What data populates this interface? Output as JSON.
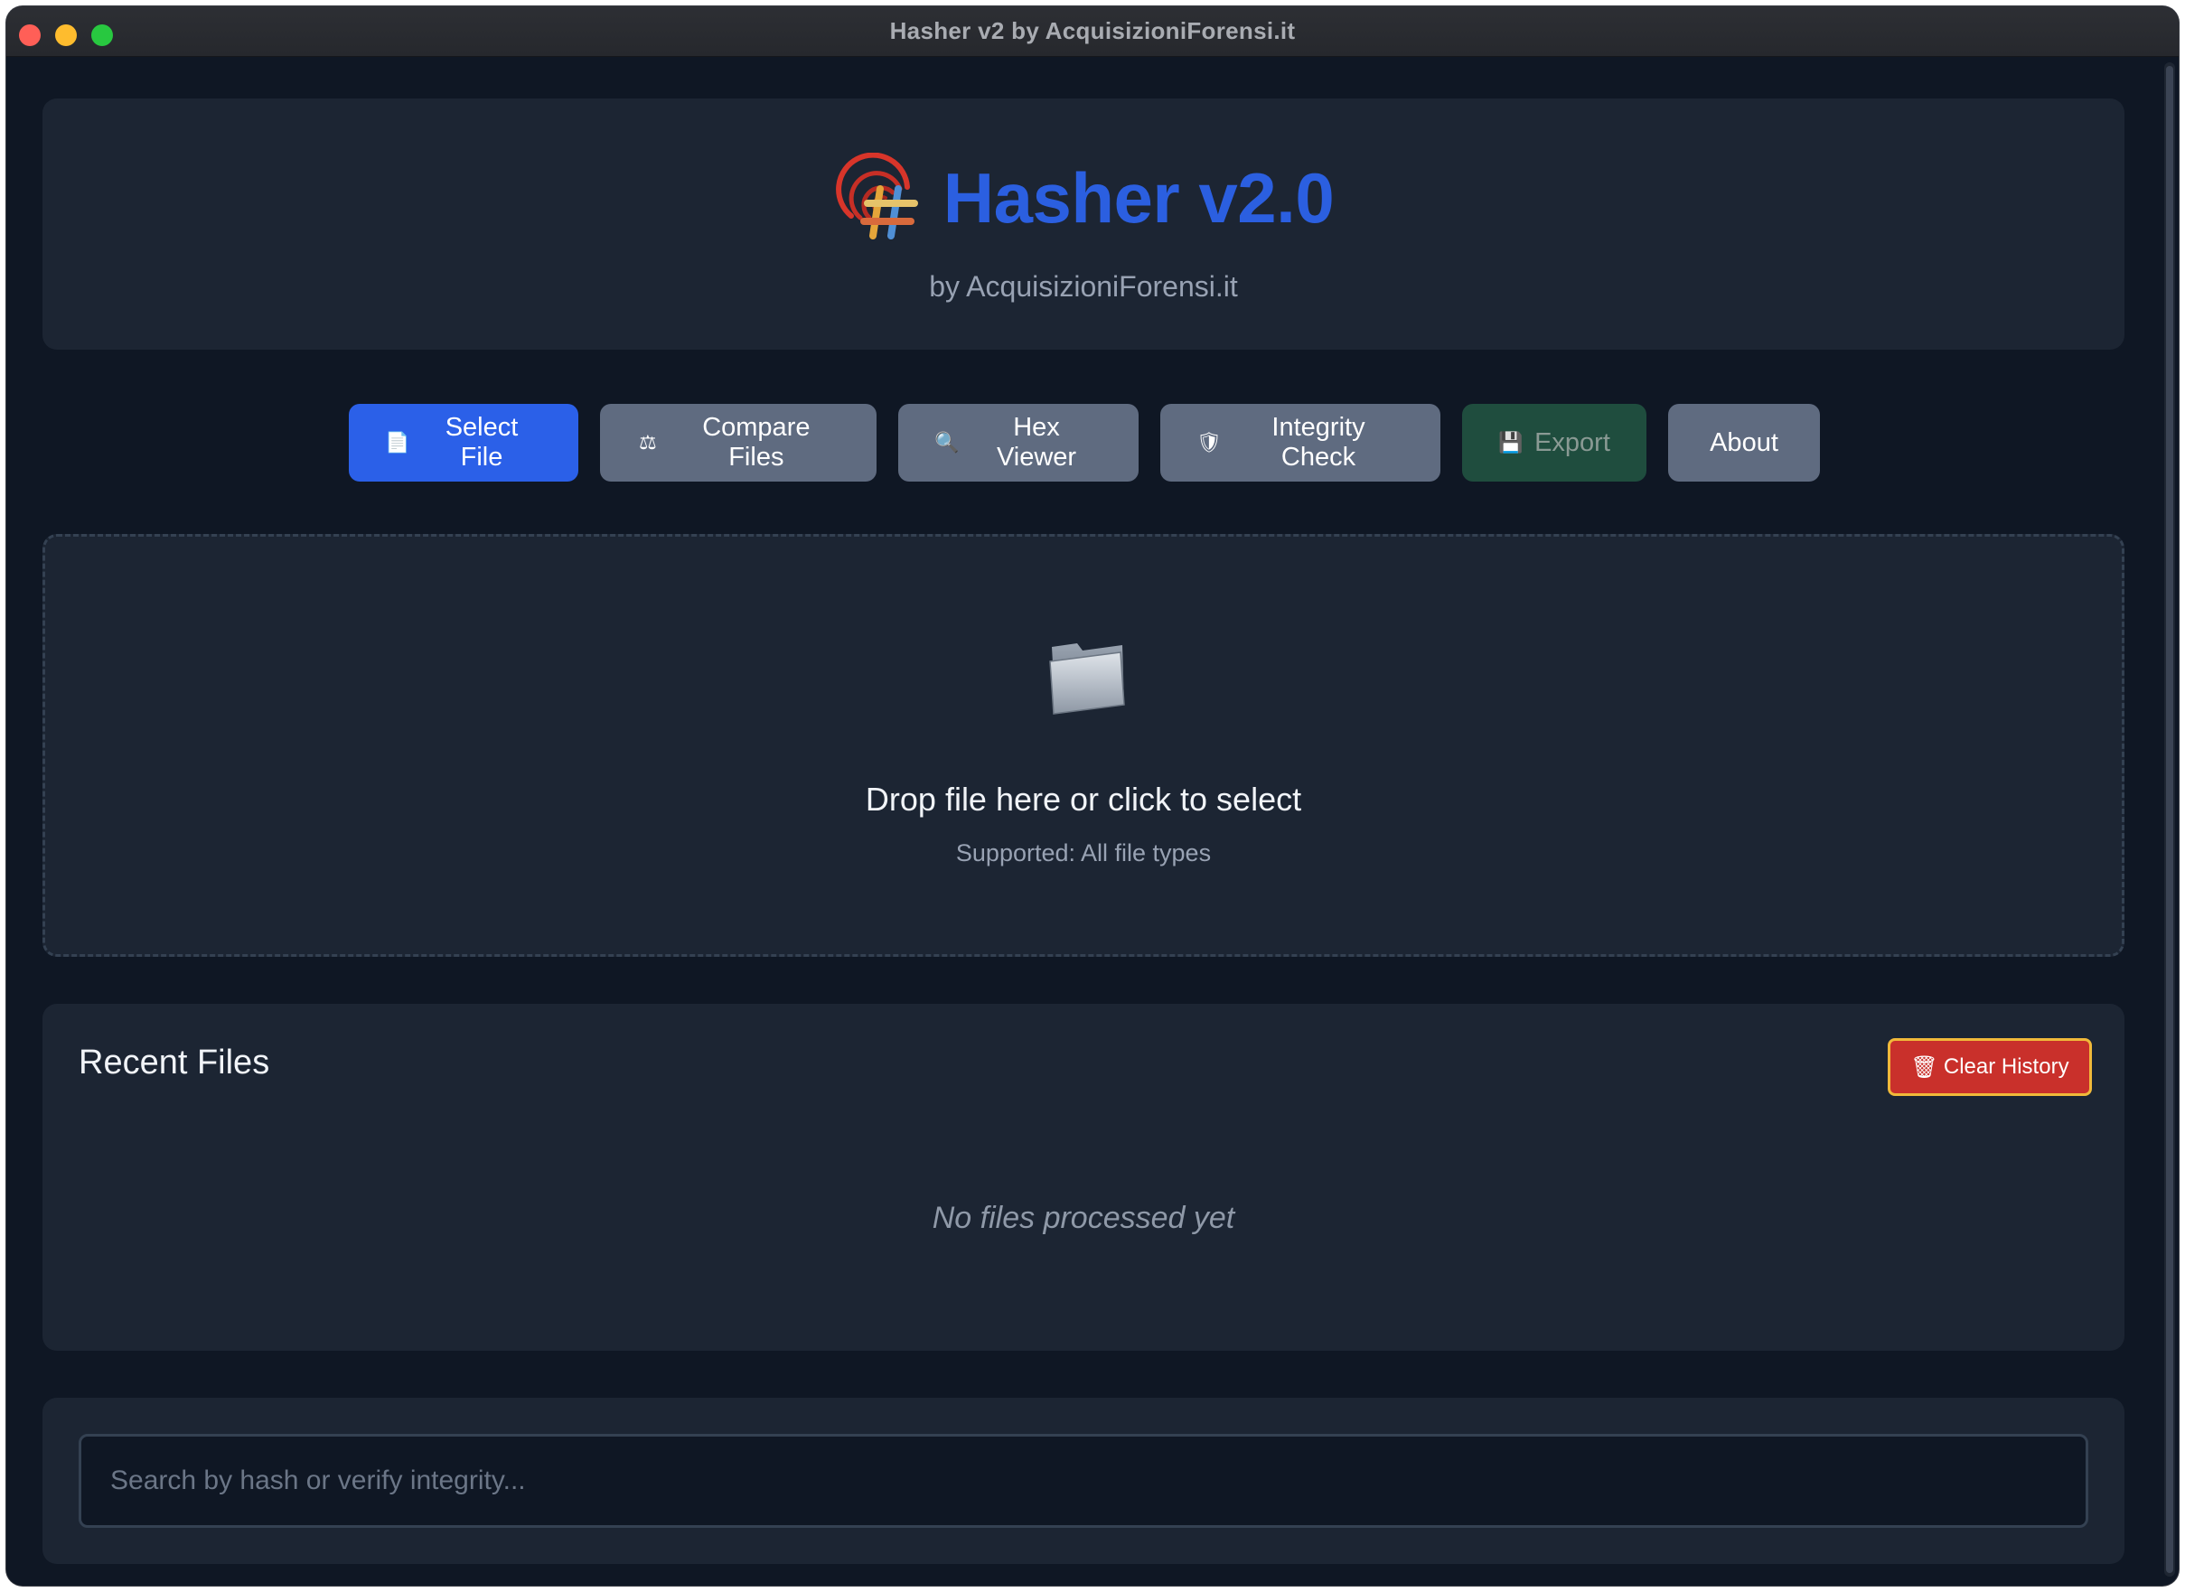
{
  "window": {
    "title": "Hasher v2 by AcquisizioniForensi.it"
  },
  "header": {
    "app_title": "Hasher v2.0",
    "subtitle": "by AcquisizioniForensi.it",
    "logo_icon": "fingerprint-hash-logo"
  },
  "toolbar": {
    "buttons": [
      {
        "label": "Select File",
        "icon": "document-icon",
        "glyph": "📄"
      },
      {
        "label": "Compare Files",
        "icon": "compare-icon",
        "glyph": "⚖"
      },
      {
        "label": "Hex Viewer",
        "icon": "magnifier-icon",
        "glyph": "🔍"
      },
      {
        "label": "Integrity Check",
        "icon": "shield-icon",
        "glyph": "🛡"
      },
      {
        "label": "Export",
        "icon": "floppy-disk-icon",
        "glyph": "💾"
      },
      {
        "label": "About",
        "icon": "",
        "glyph": ""
      }
    ]
  },
  "dropzone": {
    "icon": "folder-icon",
    "title": "Drop file here or click to select",
    "subtitle": "Supported: All file types"
  },
  "recent": {
    "title": "Recent Files",
    "clear_label": "Clear History",
    "clear_icon": "trash-icon",
    "empty_message": "No files processed yet"
  },
  "search": {
    "placeholder": "Search by hash or verify integrity...",
    "value": ""
  },
  "colors": {
    "accent": "#2b60e8",
    "title_blue": "#2b5fe0",
    "background": "#0f1724",
    "card": "#1c2533",
    "danger": "#c9302b",
    "export_green": "#1f4d3e"
  }
}
